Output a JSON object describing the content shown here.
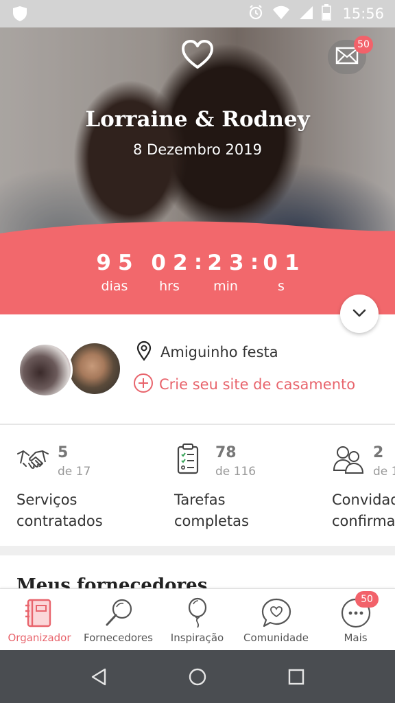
{
  "status_bar": {
    "time": "15:56",
    "icons": [
      "shield-icon",
      "alarm-icon",
      "wifi-icon",
      "signal-icon",
      "battery-icon"
    ]
  },
  "hero": {
    "couple_names": "Lorraine & Rodney",
    "wedding_date": "8 Dezembro 2019",
    "mail_badge": "50",
    "icons": [
      "heart-icon",
      "mail-icon"
    ]
  },
  "countdown": {
    "days": "95",
    "days_label": "dias",
    "hours": "02",
    "hours_label": "hrs",
    "minutes": "23",
    "minutes_label": "min",
    "seconds": "01",
    "seconds_label": "s",
    "separator": ":"
  },
  "couple_info": {
    "location": "Amiguinho festa",
    "create_site": "Crie seu site de casamento"
  },
  "stats": [
    {
      "count": "5",
      "of": "de 17",
      "label_line1": "Serviços",
      "label_line2": "contratados",
      "icon": "handshake-icon"
    },
    {
      "count": "78",
      "of": "de 116",
      "label_line1": "Tarefas",
      "label_line2": "completas",
      "icon": "checklist-icon"
    },
    {
      "count": "2",
      "of": "de 1",
      "label_line1": "Convidad",
      "label_line2": "confirma",
      "icon": "guests-icon"
    }
  ],
  "section": {
    "title": "Meus fornecedores"
  },
  "bottom_nav": {
    "items": [
      {
        "label": "Organizador",
        "icon": "organizer-icon",
        "active": true
      },
      {
        "label": "Fornecedores",
        "icon": "magnifier-icon",
        "active": false
      },
      {
        "label": "Inspiração",
        "icon": "balloon-icon",
        "active": false
      },
      {
        "label": "Comunidade",
        "icon": "chat-heart-icon",
        "active": false
      },
      {
        "label": "Mais",
        "icon": "more-icon",
        "active": false
      }
    ],
    "more_badge": "50"
  },
  "colors": {
    "accent": "#f2626a",
    "accent_text": "#e8646c",
    "countdown_bg": "#f2686c",
    "system_nav": "#4a4d51"
  }
}
